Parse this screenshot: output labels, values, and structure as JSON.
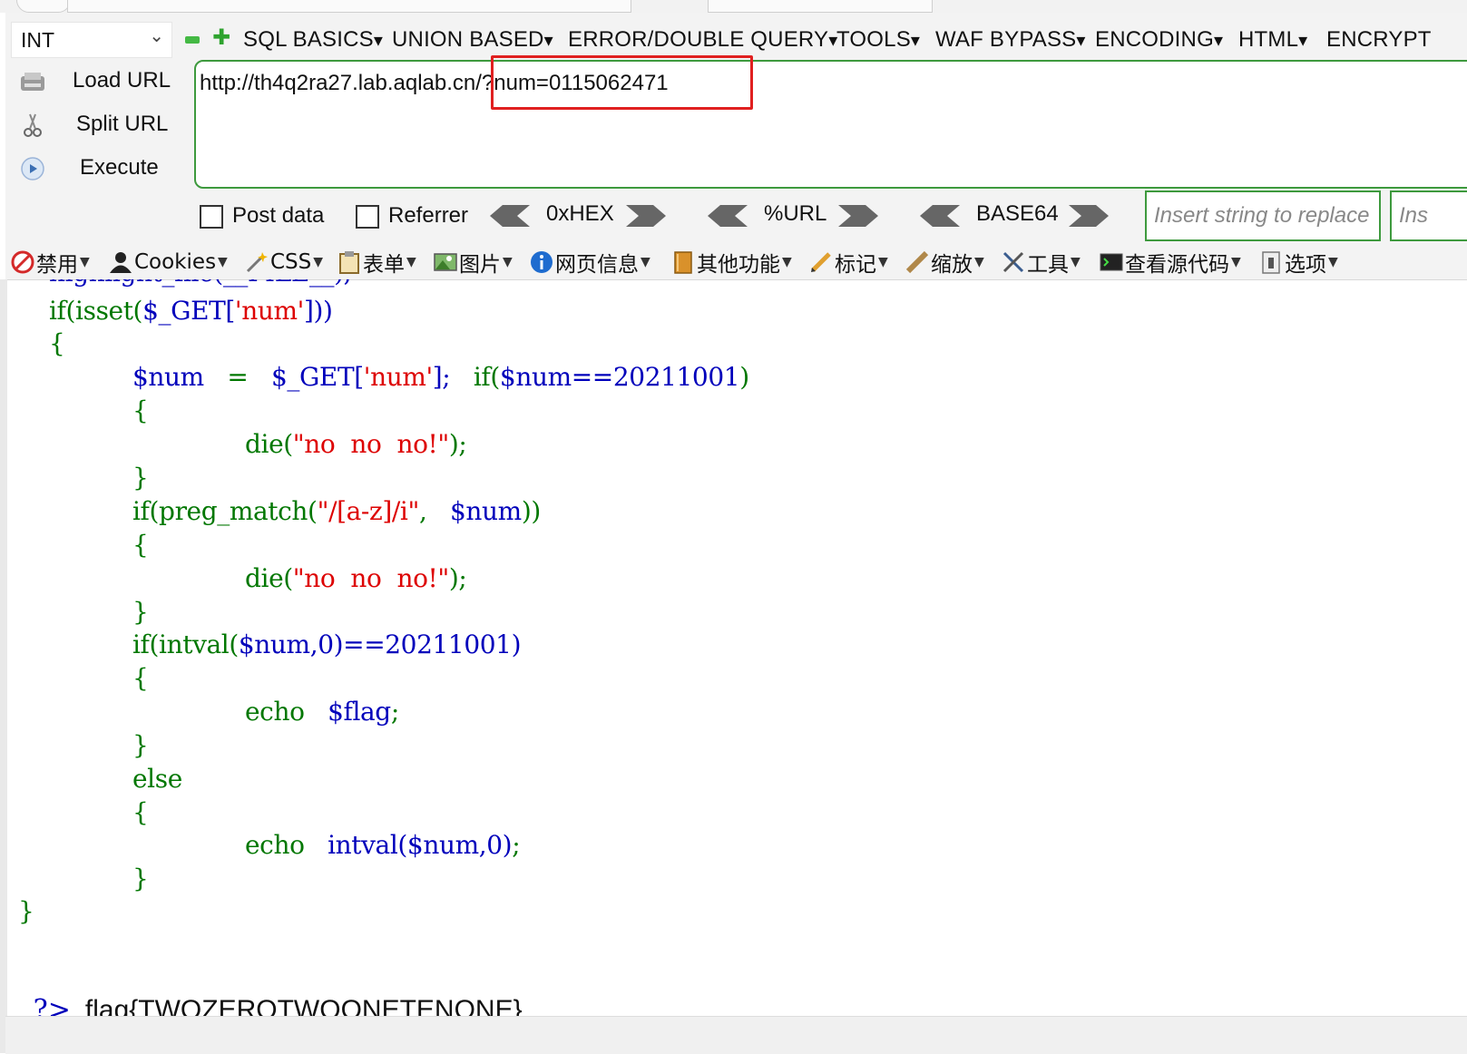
{
  "hackbar": {
    "mode_select": "INT",
    "menus": [
      "SQL BASICS",
      "UNION BASED",
      "ERROR/DOUBLE QUERY",
      "TOOLS",
      "WAF BYPASS",
      "ENCODING",
      "HTML",
      "ENCRYPT"
    ],
    "load_url": "Load URL",
    "split_url": "Split URL",
    "execute": "Execute",
    "url_value": "http://th4q2ra27.lab.aqlab.cn/?num=0115062471",
    "post_data": "Post data",
    "referrer": "Referrer",
    "hex": "0xHEX",
    "url_enc": "%URL",
    "base64": "BASE64",
    "replace_placeholder": "Insert string to replace",
    "replace2_placeholder": "Ins"
  },
  "toolbar": {
    "items": [
      "禁用",
      "Cookies",
      "CSS",
      "表单",
      "图片",
      "网页信息",
      "其他功能",
      "标记",
      "缩放",
      "工具",
      "查看源代码",
      "选项"
    ]
  },
  "code": {
    "l0": "highlight_file(__FILE__);",
    "l1_if": "if(isset(",
    "l1_get": "$_GET[",
    "l1_str": "'num'",
    "l1_end": "]))",
    "brace_open": "{",
    "brace_close": "}",
    "l3_var": "$num",
    "l3_eq": "=",
    "l3_get": "$_GET[",
    "l3_str": "'num'",
    "l3_end": "];",
    "l3_if": "if(",
    "l3_cond": "$num==20211001",
    "l3_close": ")",
    "die": "die(",
    "die_str": "\"no  no  no!\"",
    "die_end": ");",
    "l7_if": "if(preg_match(",
    "l7_str": "\"/[a-z]/i\"",
    "l7_comma": ",",
    "l7_var": "$num",
    "l7_end": "))",
    "l11_if": "if(intval(",
    "l11_args": "$num,0",
    "l11_end": ")==20211001)",
    "echo": "echo",
    "flag_var": "$flag",
    "semi": ";",
    "else": "else",
    "intval": "intval(",
    "intval_args": "$num,0",
    "intval_end": ")"
  },
  "output": {
    "tag": "?>",
    "text": "flag{TWOZEROTWOONETENONE}"
  }
}
